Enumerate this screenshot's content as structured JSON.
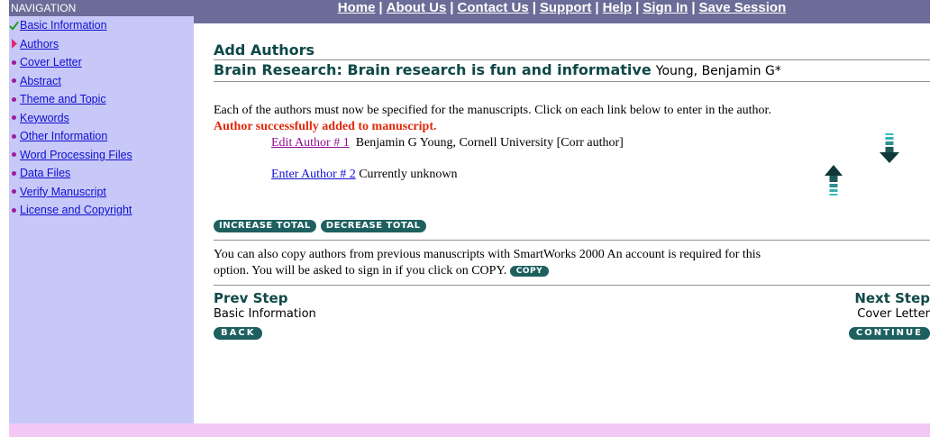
{
  "nav": {
    "header": "NAVIGATION",
    "items": [
      {
        "label": "Basic Information",
        "marker": "check"
      },
      {
        "label": "Authors",
        "marker": "arrow"
      },
      {
        "label": "Cover Letter",
        "marker": "dot"
      },
      {
        "label": "Abstract",
        "marker": "dot"
      },
      {
        "label": "Theme and Topic",
        "marker": "dot"
      },
      {
        "label": "Keywords",
        "marker": "dot"
      },
      {
        "label": "Other Information",
        "marker": "dot"
      },
      {
        "label": "Word Processing Files",
        "marker": "dot"
      },
      {
        "label": "Data Files",
        "marker": "dot"
      },
      {
        "label": "Verify Manuscript",
        "marker": "dot"
      },
      {
        "label": "License and Copyright",
        "marker": "dot"
      }
    ]
  },
  "topnav": {
    "home": "Home",
    "about": "About Us",
    "contact": "Contact Us",
    "support": "Support",
    "help": "Help",
    "signin": "Sign In",
    "save": "Save Session",
    "separator": "|"
  },
  "page": {
    "heading": "Add Authors",
    "manuscript_title": "Brain Research: Brain research is fun and informative",
    "manuscript_author": "Young, Benjamin G*",
    "instructions": "Each of the authors must now be specified for the manuscripts. Click on each link below to enter in the author.",
    "success": "Author successfully added to manuscript."
  },
  "authors": {
    "a1_link": "Edit Author # 1",
    "a1_text": "Benjamin G Young, Cornell University [Corr author]",
    "a2_link": "Enter Author # 2",
    "a2_text": "Currently unknown"
  },
  "buttons": {
    "increase": "INCREASE TOTAL",
    "decrease": "DECREASE TOTAL",
    "copy": "COPY",
    "back": "BACK",
    "continue": "CONTINUE"
  },
  "copy_text": {
    "line1": "You can also copy authors from previous manuscripts with SmartWorks 2000  An account is required for this",
    "line2": "option. You will be asked to sign in if you click on COPY."
  },
  "steps": {
    "prev_label": "Prev Step",
    "prev_name": "Basic Information",
    "next_label": "Next Step",
    "next_name": "Cover Letter"
  },
  "colors": {
    "nav_bg": "#c8c8f8",
    "bar_bg": "#6c6c98",
    "heading": "#104848",
    "button": "#1e6060",
    "success": "#e02808",
    "footer": "#f4c8f4"
  }
}
